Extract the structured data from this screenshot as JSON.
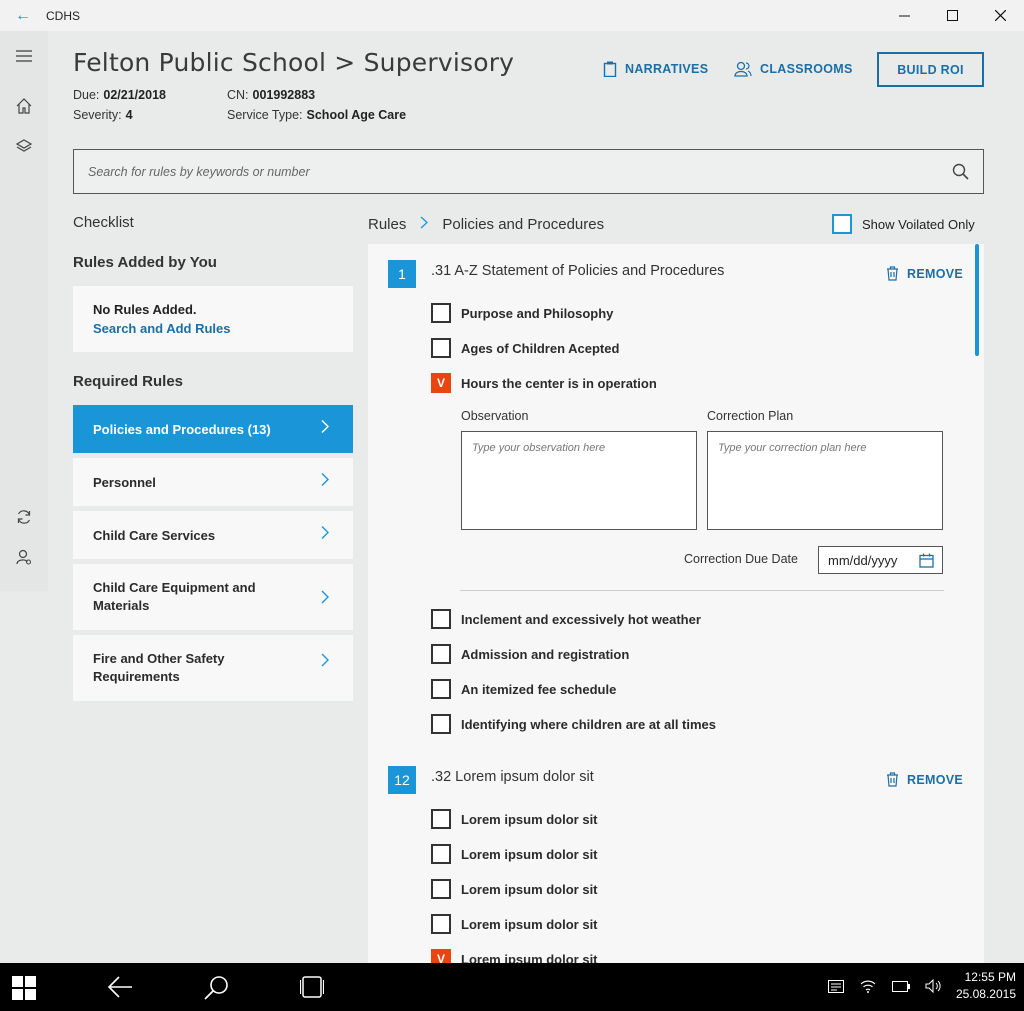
{
  "window": {
    "title": "CDHS",
    "back_glyph": "←"
  },
  "header": {
    "title": "Felton Public School > Supervisory",
    "due_label": "Due:",
    "due_value": "02/21/2018",
    "severity_label": "Severity:",
    "severity_value": "4",
    "cn_label": "CN:",
    "cn_value": "001992883",
    "service_label": "Service Type:",
    "service_value": "School Age Care"
  },
  "actions": {
    "narratives": "NARRATIVES",
    "classrooms": "CLASSROOMS",
    "build_roi": "BUILD ROI"
  },
  "search": {
    "placeholder": "Search for rules by keywords or number"
  },
  "sidebar": {
    "checklist_label": "Checklist",
    "rules_added_heading": "Rules Added by You",
    "no_rules_text": "No Rules Added.",
    "search_add_link": "Search and Add Rules",
    "required_heading": "Required Rules",
    "categories": [
      {
        "label": "Policies and Procedures (13)",
        "active": true
      },
      {
        "label": "Personnel",
        "active": false
      },
      {
        "label": "Child Care Services",
        "active": false
      },
      {
        "label": "Child Care Equipment and Materials",
        "active": false
      },
      {
        "label": "Fire and Other Safety Requirements",
        "active": false
      }
    ]
  },
  "breadcrumb": {
    "root": "Rules",
    "current": "Policies and Procedures"
  },
  "filter": {
    "show_violated_label": "Show Voilated Only",
    "checked": false
  },
  "rules": [
    {
      "number": "1",
      "title": ".31 A-Z Statement of Policies and Procedures",
      "remove_label": "REMOVE",
      "items": [
        {
          "label": "Purpose and Philosophy",
          "checked": false
        },
        {
          "label": "Ages of Children Acepted",
          "checked": false
        },
        {
          "label": "Hours the center is in operation",
          "checked": true
        },
        {
          "label": "Inclement and excessively hot weather",
          "checked": false
        },
        {
          "label": "Admission and registration",
          "checked": false
        },
        {
          "label": "An itemized fee schedule",
          "checked": false
        },
        {
          "label": "Identifying where children are at all times",
          "checked": false
        }
      ],
      "violation": {
        "observation_label": "Observation",
        "observation_placeholder": "Type your observation here",
        "correction_label": "Correction Plan",
        "correction_placeholder": "Type your correction plan here",
        "due_date_label": "Correction Due Date",
        "due_date_placeholder": "mm/dd/yyyy"
      }
    },
    {
      "number": "12",
      "title": ".32 Lorem ipsum dolor sit",
      "remove_label": "REMOVE",
      "items": [
        {
          "label": "Lorem ipsum dolor sit",
          "checked": false
        },
        {
          "label": "Lorem ipsum dolor sit",
          "checked": false
        },
        {
          "label": "Lorem ipsum dolor sit",
          "checked": false
        },
        {
          "label": "Lorem ipsum dolor sit",
          "checked": false
        },
        {
          "label": "Lorem ipsum dolor sit",
          "checked": true
        }
      ]
    }
  ],
  "check_mark": "V",
  "taskbar": {
    "time": "12:55 PM",
    "date": "25.08.2015"
  },
  "colors": {
    "accent": "#1a96d8",
    "link": "#1a6fa8",
    "violation": "#e8450f"
  }
}
